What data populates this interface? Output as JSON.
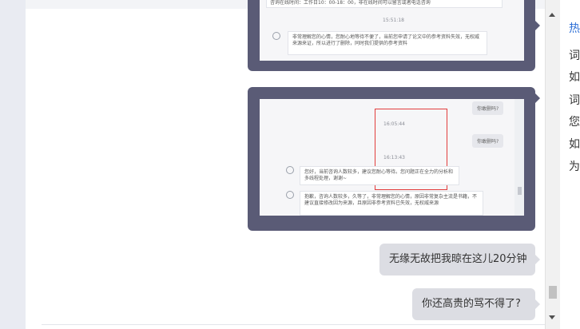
{
  "chat": {
    "screenshot1": {
      "top_text": "咨询在线时间：工作日10：00-18：00，非在线时间可以留言或者电话咨询",
      "time": "15:51:18",
      "message": "非常理解您的心情，您耐心地等待不便了，当前您申请了论文中的参考资料失效，无权威来源来证，所以进行了删除，同时我们提供的参考资料"
    },
    "screenshot2": {
      "bubble_a": "你敢删吗?",
      "time_a": "16:05:44",
      "bubble_b": "你敢删吗?",
      "time_b": "16:13:43",
      "message1": "您好，当前咨询人数较多，建议您耐心等待。您问题正在全力的分析和多线程处理，谢谢~",
      "message2": "抱歉，咨询人数较多，久等了，非常理解您的心情，原因非常复杂主流是书籍，不建议直接修改因为来源，且原因非参考资料已失效，无权威来源"
    },
    "messages": [
      {
        "text": "无缘无故把我晾在这儿20分钟"
      },
      {
        "text": "你还高贵的骂不得了?"
      }
    ]
  },
  "right_panel": {
    "heading": "热",
    "lines": [
      "词",
      "如",
      "词",
      "您",
      "如",
      "为"
    ]
  },
  "colors": {
    "screenshot_frame": "#5a5b76",
    "bubble": "#dcdde3",
    "highlight_box": "#e23d3d",
    "link": "#2d6fd6"
  }
}
